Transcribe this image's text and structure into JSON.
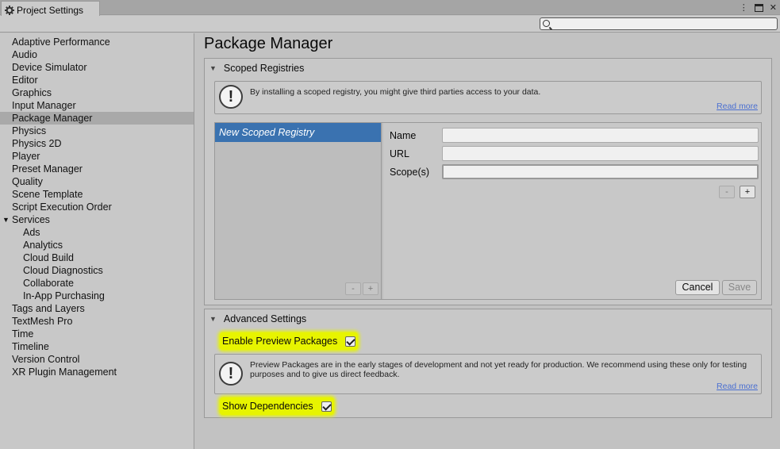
{
  "window": {
    "tab_title": "Project Settings",
    "icons": [
      "more-vert-icon",
      "maximize-icon",
      "close-icon"
    ]
  },
  "search": {
    "value": "",
    "placeholder": ""
  },
  "sidebar": {
    "items": [
      {
        "label": "Adaptive Performance"
      },
      {
        "label": "Audio"
      },
      {
        "label": "Device Simulator"
      },
      {
        "label": "Editor"
      },
      {
        "label": "Graphics"
      },
      {
        "label": "Input Manager"
      },
      {
        "label": "Package Manager",
        "selected": true
      },
      {
        "label": "Physics"
      },
      {
        "label": "Physics 2D"
      },
      {
        "label": "Player"
      },
      {
        "label": "Preset Manager"
      },
      {
        "label": "Quality"
      },
      {
        "label": "Scene Template"
      },
      {
        "label": "Script Execution Order"
      },
      {
        "label": "Services",
        "expanded": true
      },
      {
        "label": "Ads",
        "child": true
      },
      {
        "label": "Analytics",
        "child": true
      },
      {
        "label": "Cloud Build",
        "child": true
      },
      {
        "label": "Cloud Diagnostics",
        "child": true
      },
      {
        "label": "Collaborate",
        "child": true
      },
      {
        "label": "In-App Purchasing",
        "child": true
      },
      {
        "label": "Tags and Layers"
      },
      {
        "label": "TextMesh Pro"
      },
      {
        "label": "Time"
      },
      {
        "label": "Timeline"
      },
      {
        "label": "Version Control"
      },
      {
        "label": "XR Plugin Management"
      }
    ]
  },
  "main": {
    "title": "Package Manager",
    "scoped": {
      "header": "Scoped Registries",
      "help_text": "By installing a scoped registry, you might give third parties access to your data.",
      "read_more": "Read more",
      "registry_item": "New Scoped Registry",
      "list_minus": "-",
      "list_plus": "+",
      "name_label": "Name",
      "url_label": "URL",
      "scope_label": "Scope(s)",
      "name_value": "",
      "url_value": "",
      "scope_value": "",
      "scope_minus": "-",
      "scope_plus": "+",
      "cancel": "Cancel",
      "save": "Save"
    },
    "advanced": {
      "header": "Advanced Settings",
      "enable_preview_label": "Enable Preview Packages",
      "enable_preview_checked": true,
      "help_text": "Preview Packages are in the early stages of development and not yet ready for production. We recommend using these only for testing purposes and to give us direct feedback.",
      "read_more": "Read more",
      "show_deps_label": "Show Dependencies",
      "show_deps_checked": true
    }
  },
  "colors": {
    "selection_blue": "#3a72b0",
    "highlight_yellow": "#e7f400",
    "link_blue": "#4a6fd1"
  }
}
